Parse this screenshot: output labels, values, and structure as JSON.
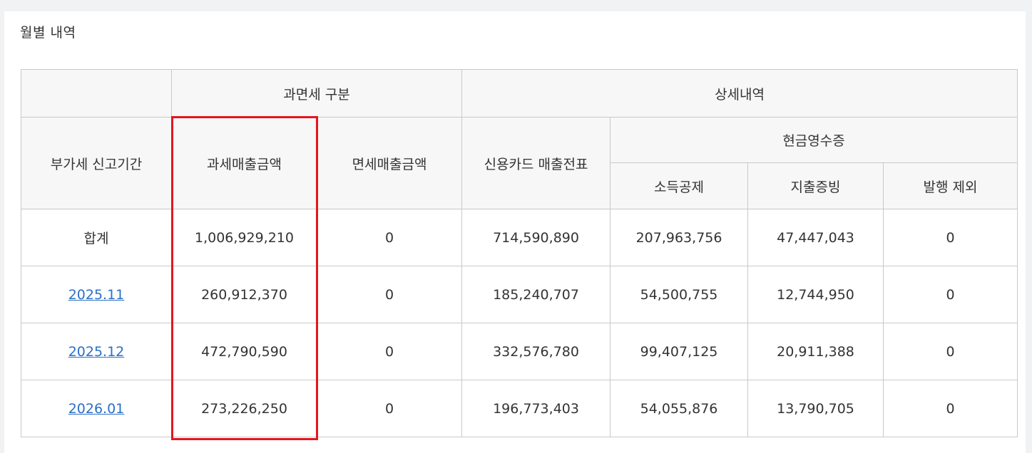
{
  "section_title": "월별 내역",
  "header": {
    "group_tax_type": "과면세 구분",
    "group_detail": "상세내역",
    "period": "부가세 신고기간",
    "taxable_sales": "과세매출금액",
    "exempt_sales": "면세매출금액",
    "credit_card": "신용카드 매출전표",
    "cash_receipt": "현금영수증",
    "income_deduction": "소득공제",
    "expense_proof": "지출증빙",
    "excluded": "발행 제외"
  },
  "rows": [
    {
      "period": "합계",
      "taxable": "1,006,929,210",
      "exempt": "0",
      "card": "714,590,890",
      "income": "207,963,756",
      "expense": "47,447,043",
      "excluded": "0"
    },
    {
      "period": "2025.11",
      "taxable": "260,912,370",
      "exempt": "0",
      "card": "185,240,707",
      "income": "54,500,755",
      "expense": "12,744,950",
      "excluded": "0"
    },
    {
      "period": "2025.12",
      "taxable": "472,790,590",
      "exempt": "0",
      "card": "332,576,780",
      "income": "99,407,125",
      "expense": "20,911,388",
      "excluded": "0"
    },
    {
      "period": "2026.01",
      "taxable": "273,226,250",
      "exempt": "0",
      "card": "196,773,403",
      "income": "54,055,876",
      "expense": "13,790,705",
      "excluded": "0"
    }
  ],
  "colors": {
    "highlight": "#e4161f",
    "link": "#2b6fc6",
    "header_bg": "#f7f7f7",
    "border": "#c9c9c9"
  }
}
